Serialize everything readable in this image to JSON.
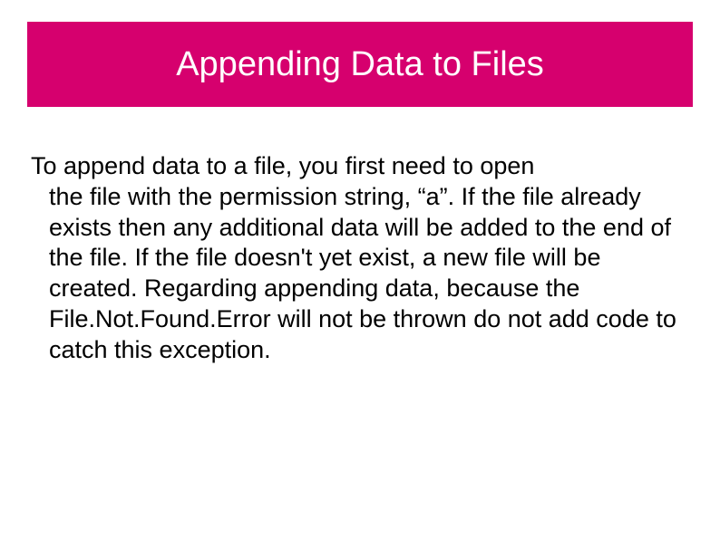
{
  "slide": {
    "title": "Appending Data to Files",
    "body_first": "To append data to a file, you first need to open",
    "body_rest": "the file with the permission string, “a”.  If the file already exists then any additional data will be added to the end of the file.  If the file doesn't yet exist, a new file will be created.  Regarding appending data, because the File.Not.Found.Error will not be thrown do not add code to catch this exception."
  }
}
